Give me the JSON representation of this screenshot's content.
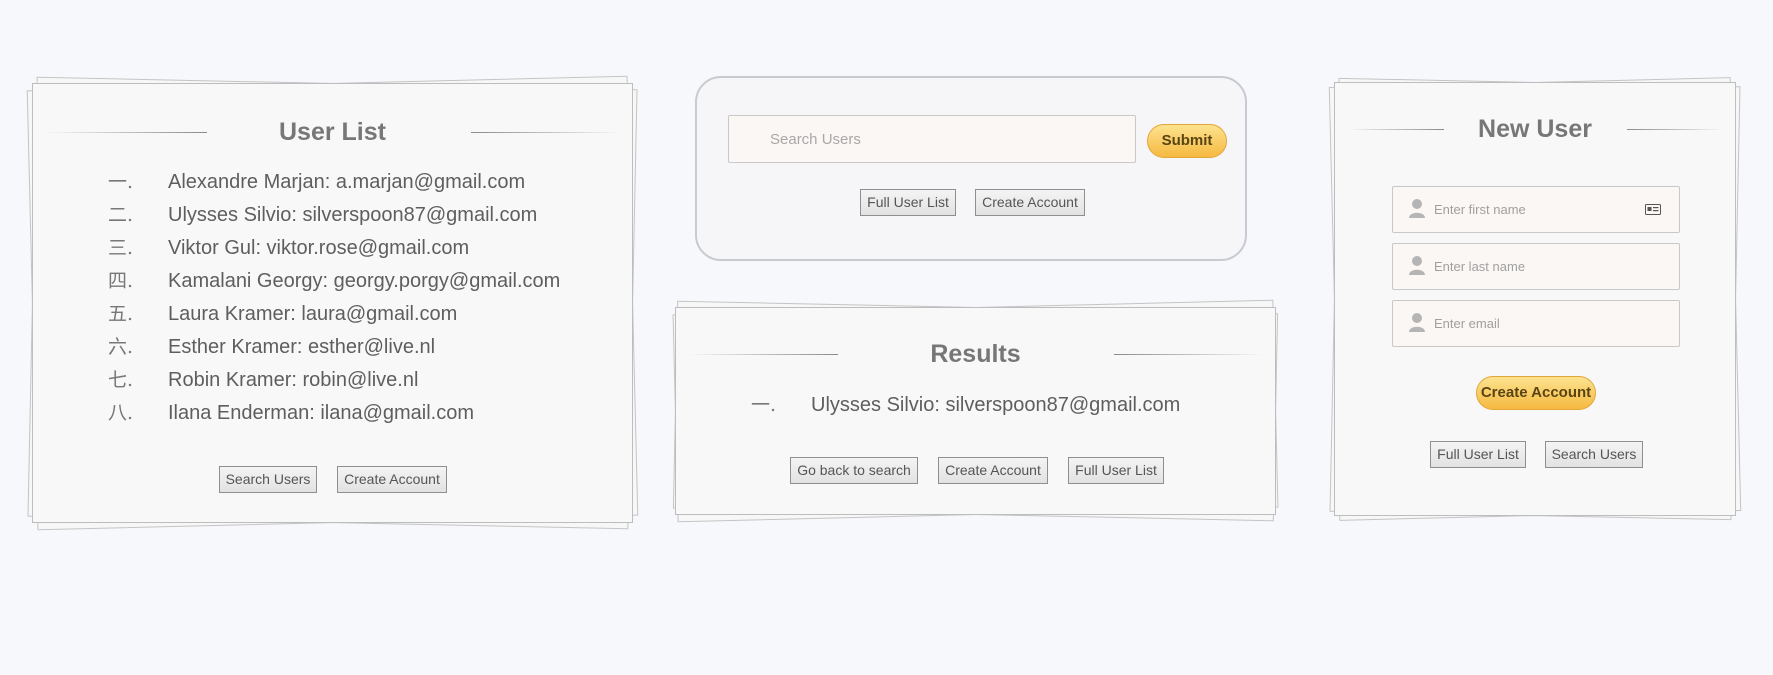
{
  "user_list": {
    "title": "User List",
    "items": [
      {
        "num": "一.",
        "text": "Alexandre Marjan: a.marjan@gmail.com"
      },
      {
        "num": "二.",
        "text": "Ulysses Silvio: silverspoon87@gmail.com"
      },
      {
        "num": "三.",
        "text": "Viktor Gul: viktor.rose@gmail.com"
      },
      {
        "num": "四.",
        "text": "Kamalani Georgy: georgy.porgy@gmail.com"
      },
      {
        "num": "五.",
        "text": "Laura Kramer: laura@gmail.com"
      },
      {
        "num": "六.",
        "text": "Esther Kramer: esther@live.nl"
      },
      {
        "num": "七.",
        "text": "Robin Kramer: robin@live.nl"
      },
      {
        "num": "八.",
        "text": "Ilana Enderman: ilana@gmail.com"
      }
    ],
    "buttons": {
      "search_users": "Search Users",
      "create_account": "Create Account"
    }
  },
  "search": {
    "placeholder": "Search Users",
    "submit_label": "Submit",
    "buttons": {
      "full_user_list": "Full User List",
      "create_account": "Create Account"
    }
  },
  "results": {
    "title": "Results",
    "items": [
      {
        "num": "一.",
        "text": "Ulysses Silvio: silverspoon87@gmail.com"
      }
    ],
    "buttons": {
      "go_back": "Go back to search",
      "create_account": "Create Account",
      "full_user_list": "Full User List"
    }
  },
  "new_user": {
    "title": "New User",
    "first_name_placeholder": "Enter first name",
    "last_name_placeholder": "Enter last name",
    "email_placeholder": "Enter email",
    "create_label": "Create Account",
    "buttons": {
      "full_user_list": "Full User List",
      "search_users": "Search Users"
    }
  }
}
